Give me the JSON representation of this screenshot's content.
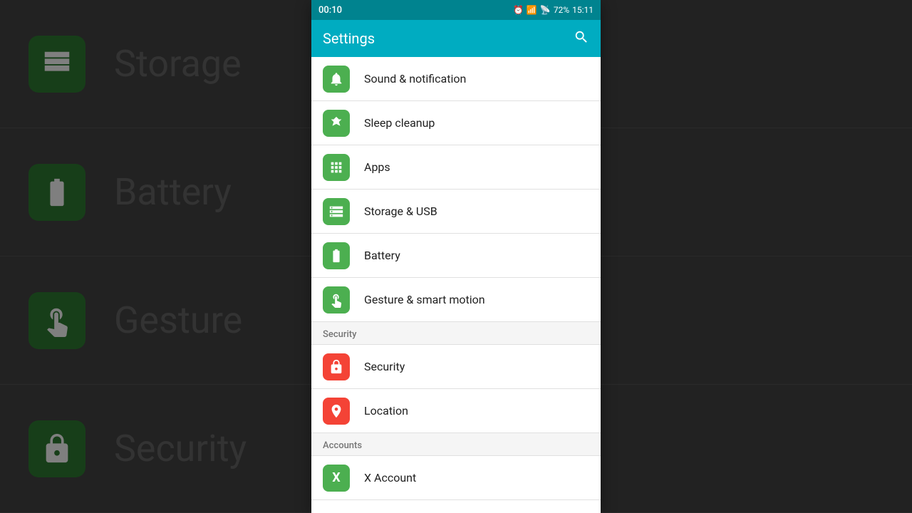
{
  "statusBar": {
    "timeLeft": "00:10",
    "timeRight": "15:11",
    "battery": "72%"
  },
  "header": {
    "title": "Settings"
  },
  "background": {
    "items": [
      {
        "label": "Storage",
        "icon": "list"
      },
      {
        "label": "Battery",
        "icon": "battery"
      },
      {
        "label": "Gesture",
        "icon": "hand"
      },
      {
        "label": "Security",
        "icon": "lock"
      }
    ]
  },
  "sections": [
    {
      "items": [
        {
          "id": "sound",
          "label": "Sound & notification",
          "iconType": "green",
          "icon": "bell"
        },
        {
          "id": "sleep",
          "label": "Sleep cleanup",
          "iconType": "green",
          "icon": "leaf"
        },
        {
          "id": "apps",
          "label": "Apps",
          "iconType": "green",
          "icon": "apps"
        },
        {
          "id": "storage",
          "label": "Storage & USB",
          "iconType": "green",
          "icon": "storage"
        },
        {
          "id": "battery",
          "label": "Battery",
          "iconType": "green",
          "icon": "battery"
        },
        {
          "id": "gesture",
          "label": "Gesture & smart motion",
          "iconType": "green",
          "icon": "hand"
        }
      ]
    },
    {
      "header": "Security",
      "items": [
        {
          "id": "security",
          "label": "Security",
          "iconType": "red",
          "icon": "lock"
        },
        {
          "id": "location",
          "label": "Location",
          "iconType": "red",
          "icon": "location"
        }
      ]
    },
    {
      "header": "Accounts",
      "items": [
        {
          "id": "xaccount",
          "label": "X Account",
          "iconType": "green",
          "icon": "x"
        }
      ]
    }
  ]
}
